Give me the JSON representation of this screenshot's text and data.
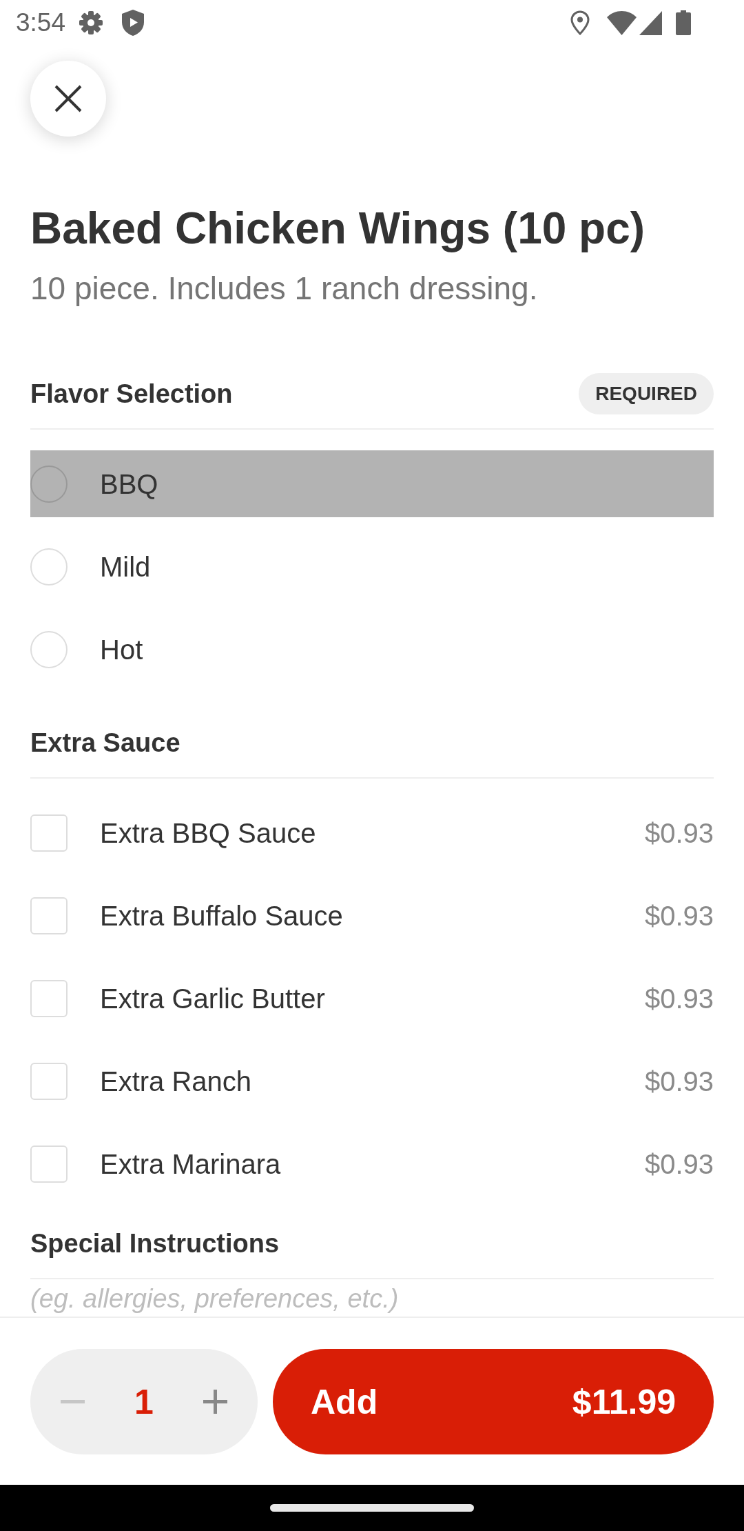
{
  "status_bar": {
    "time": "3:54"
  },
  "item": {
    "title": "Baked Chicken Wings (10 pc)",
    "description": "10 piece. Includes 1 ranch dressing."
  },
  "sections": [
    {
      "kind": "radio",
      "title": "Flavor Selection",
      "badge": "REQUIRED",
      "options": [
        {
          "label": "BBQ",
          "selected": false,
          "highlighted": true
        },
        {
          "label": "Mild",
          "selected": false,
          "highlighted": false
        },
        {
          "label": "Hot",
          "selected": false,
          "highlighted": false
        }
      ]
    },
    {
      "kind": "checkbox",
      "title": "Extra Sauce",
      "options": [
        {
          "label": "Extra BBQ Sauce",
          "price": "$0.93",
          "checked": false
        },
        {
          "label": "Extra Buffalo Sauce",
          "price": "$0.93",
          "checked": false
        },
        {
          "label": "Extra Garlic Butter",
          "price": "$0.93",
          "checked": false
        },
        {
          "label": "Extra Ranch",
          "price": "$0.93",
          "checked": false
        },
        {
          "label": "Extra Marinara",
          "price": "$0.93",
          "checked": false
        }
      ]
    },
    {
      "kind": "text",
      "title": "Special Instructions",
      "placeholder": "(eg. allergies, preferences, etc.)"
    }
  ],
  "footer": {
    "quantity": "1",
    "decrease_disabled": true,
    "add_button": {
      "label": "Add",
      "price": "$11.99"
    }
  }
}
